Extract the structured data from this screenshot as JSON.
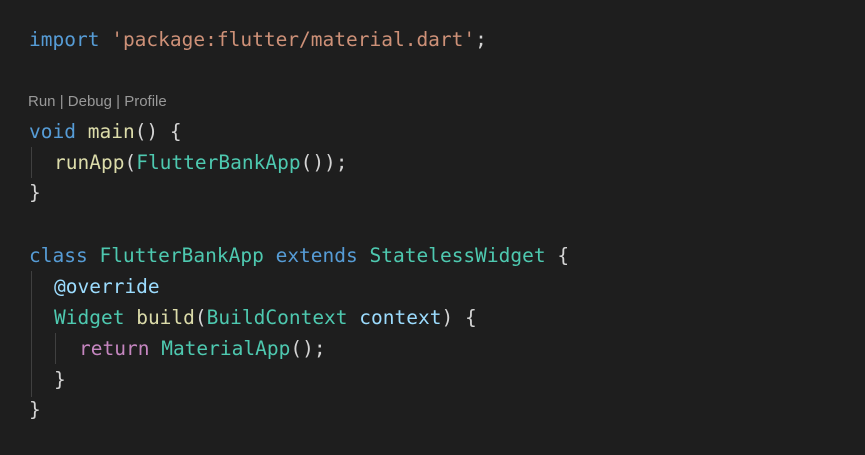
{
  "colors": {
    "background": "#1e1e1e",
    "keyword": "#569cd6",
    "control": "#c586c0",
    "string": "#ce9178",
    "function": "#dcdcaa",
    "type": "#4ec9b0",
    "variable": "#9cdcfe",
    "text": "#d4d4d4",
    "codelens": "#999999",
    "indent_guide": "#404040"
  },
  "codelens": {
    "run": "Run",
    "sep1": " | ",
    "debug": "Debug",
    "sep2": " | ",
    "profile": "Profile"
  },
  "code": {
    "l1": {
      "kw": "import",
      "sp": " ",
      "str": "'package:flutter/material.dart'",
      "end": ";"
    },
    "l2": {
      "kw": "void",
      "sp": " ",
      "fn": "main",
      "end": "() {"
    },
    "l3": {
      "fn": "runApp",
      "p1": "(",
      "ty": "FlutterBankApp",
      "end": "());"
    },
    "l4": {
      "end": "}"
    },
    "l5": {
      "kw1": "class",
      "sp1": " ",
      "ty1": "FlutterBankApp",
      "sp2": " ",
      "kw2": "extends",
      "sp3": " ",
      "ty2": "StatelessWidget",
      "end": " {"
    },
    "l6": {
      "var": "@override"
    },
    "l7": {
      "ty1": "Widget",
      "sp1": " ",
      "fn": "build",
      "p1": "(",
      "ty2": "BuildContext",
      "sp2": " ",
      "var": "context",
      "end": ") {"
    },
    "l8": {
      "ctl": "return",
      "sp": " ",
      "ty": "MaterialApp",
      "end": "();"
    },
    "l9": {
      "end": "}"
    },
    "l10": {
      "end": "}"
    }
  }
}
